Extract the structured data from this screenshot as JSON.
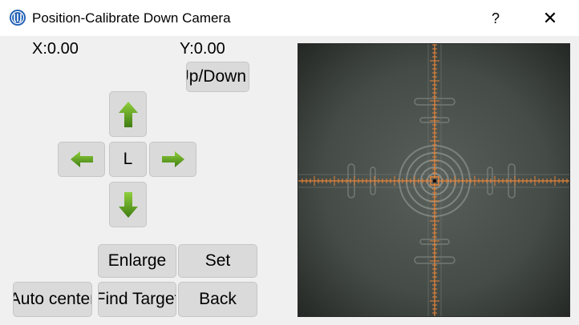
{
  "window": {
    "title": "Position-Calibrate Down Camera",
    "help_label": "?",
    "close_label": "✕",
    "app_icon": "app-logo-icon"
  },
  "coords": {
    "x_label": "X:0.00",
    "y_label": "Y:0.00"
  },
  "controls": {
    "updown_label": "Up/Down",
    "center_label": "L",
    "up_icon": "arrow-up-icon",
    "down_icon": "arrow-down-icon",
    "left_icon": "arrow-left-icon",
    "right_icon": "arrow-right-icon",
    "enlarge_label": "Enlarge",
    "set_label": "Set",
    "auto_center_label": "Auto center",
    "find_target_label": "Find Target",
    "back_label": "Back"
  },
  "camera": {
    "name": "down-camera-view",
    "crosshair_color": "#e8853a",
    "background_color": "#3b413d"
  },
  "colors": {
    "arrow_green": "#5a9a1e",
    "button_bg": "#dadada",
    "window_bg": "#f0f0f0"
  }
}
